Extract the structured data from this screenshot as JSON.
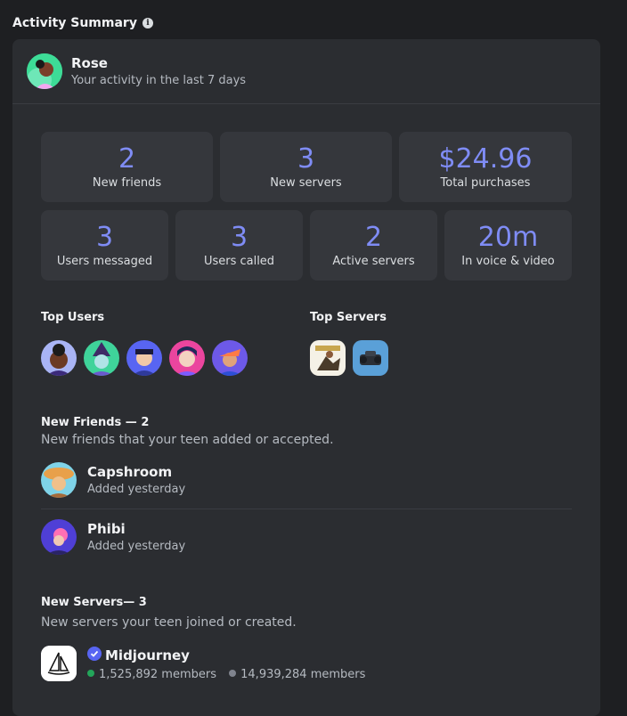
{
  "section": {
    "title": "Activity Summary",
    "info_icon": "info-icon"
  },
  "header": {
    "name": "Rose",
    "subtitle": "Your activity in the last 7 days"
  },
  "stats_top": [
    {
      "value": "2",
      "label": "New friends"
    },
    {
      "value": "3",
      "label": "New servers"
    },
    {
      "value": "$24.96",
      "label": "Total purchases"
    }
  ],
  "stats_bottom": [
    {
      "value": "3",
      "label": "Users messaged"
    },
    {
      "value": "3",
      "label": "Users called"
    },
    {
      "value": "2",
      "label": "Active servers"
    },
    {
      "value": "20m",
      "label": "In voice & video"
    }
  ],
  "top_users": {
    "title": "Top Users",
    "count": 5
  },
  "top_servers": {
    "title": "Top Servers",
    "count": 2
  },
  "new_friends": {
    "title": "New Friends — 2",
    "description": "New friends that your teen added or accepted.",
    "items": [
      {
        "name": "Capshroom",
        "status": "Added yesterday"
      },
      {
        "name": "Phibi",
        "status": "Added yesterday"
      }
    ]
  },
  "new_servers": {
    "title": "New Servers— 3",
    "description": "New servers your teen joined or created.",
    "items": [
      {
        "name": "Midjourney",
        "online": "1,525,892 members",
        "total": "14,939,284 members"
      }
    ]
  },
  "colors": {
    "accent": "#7f8cf5",
    "online": "#23a55a",
    "offline": "#80848e",
    "verified": "#5865f2"
  }
}
